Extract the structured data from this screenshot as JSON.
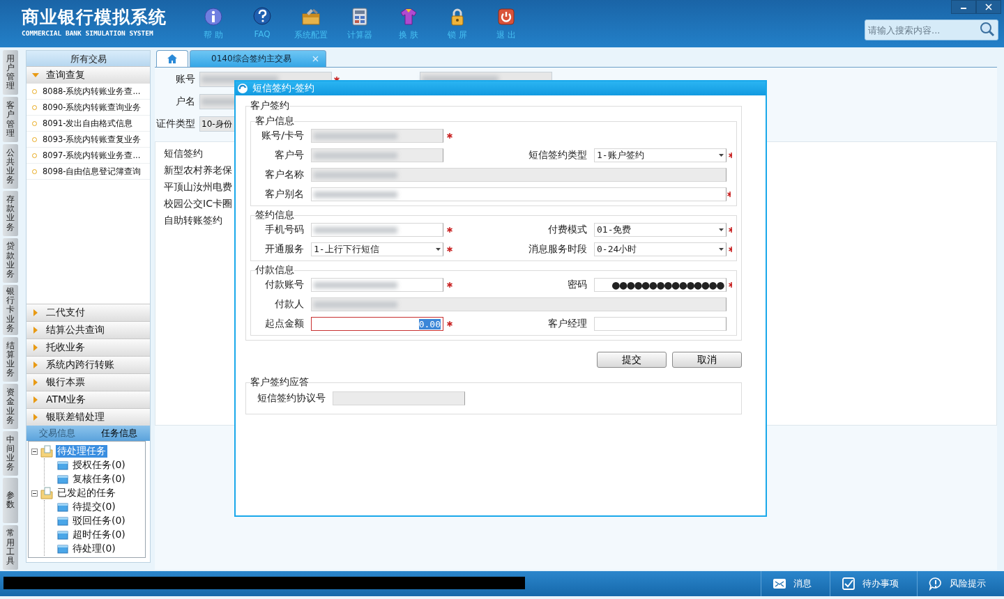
{
  "header": {
    "title": "商业银行模拟系统",
    "subtitle": "COMMERCIAL BANK SIMULATION SYSTEM",
    "tools": [
      {
        "label": "帮 助"
      },
      {
        "label": "FAQ"
      },
      {
        "label": "系统配置"
      },
      {
        "label": "计算器"
      },
      {
        "label": "换 肤"
      },
      {
        "label": "锁 屏"
      },
      {
        "label": "退 出"
      }
    ],
    "search": {
      "placeholder": "请输入搜索内容..."
    }
  },
  "side_tabs": [
    {
      "label": "用户管理"
    },
    {
      "label": "客户管理"
    },
    {
      "label": "公共业务"
    },
    {
      "label": "存款业务"
    },
    {
      "label": "贷款业务"
    },
    {
      "label": "银行卡业务"
    },
    {
      "label": "结算业务"
    },
    {
      "label": "资金业务"
    },
    {
      "label": "中间业务"
    },
    {
      "label": "参数"
    },
    {
      "label": "常用工具"
    }
  ],
  "nav": {
    "title": "所有交易",
    "groups": [
      {
        "label": "查询查复",
        "expanded": true,
        "items": [
          "8088-系统内转账业务查...",
          "8090-系统内转账查询业务",
          "8091-发出自由格式信息",
          "8093-系统内转账查复业务",
          "8097-系统内转账业务查...",
          "8098-自由信息登记簿查询"
        ]
      },
      {
        "label": "二代支付",
        "expanded": false
      },
      {
        "label": "结算公共查询",
        "expanded": false
      },
      {
        "label": "托收业务",
        "expanded": false
      },
      {
        "label": "系统内跨行转账",
        "expanded": false
      },
      {
        "label": "银行本票",
        "expanded": false
      },
      {
        "label": "ATM业务",
        "expanded": false
      },
      {
        "label": "银联差错处理",
        "expanded": false
      }
    ],
    "tabs": [
      {
        "label": "交易信息",
        "selected": false
      },
      {
        "label": "任务信息",
        "selected": true
      }
    ],
    "tree": [
      {
        "label": "待处理任务",
        "selected": true,
        "expanded": true,
        "children": [
          {
            "label": "授权任务(0)",
            "selected": false
          },
          {
            "label": "复核任务(0)",
            "selected": false
          }
        ]
      },
      {
        "label": "已发起的任务",
        "selected": false,
        "expanded": true,
        "children": [
          {
            "label": "待提交(0)",
            "selected": false
          },
          {
            "label": "驳回任务(0)",
            "selected": false
          },
          {
            "label": "超时任务(0)",
            "selected": false
          },
          {
            "label": "待处理(0)",
            "selected": false
          }
        ]
      }
    ]
  },
  "main": {
    "tabs": [
      {
        "kind": "home",
        "selected": false
      },
      {
        "kind": "text",
        "label": "0140综合签约主交易",
        "selected": true
      }
    ],
    "form": [
      [
        {
          "label": "账号",
          "redacted": true,
          "required": true
        },
        {
          "redacted": true,
          "required": false
        }
      ],
      [
        {
          "label": "户名",
          "redacted": true,
          "required": false
        }
      ],
      [
        {
          "label": "证件类型",
          "value": "10-身份",
          "required": false
        }
      ]
    ],
    "list": [
      "短信签约",
      "新型农村养老保",
      "平顶山汝州电费",
      "校园公交IC卡圈",
      "自助转账签约"
    ]
  },
  "dialog": {
    "title": "短信签约-签约",
    "form": {
      "title": "客户签约",
      "groups": [
        {
          "title": "客户信息",
          "rows": [
            [
              {
                "label": "账号/卡号",
                "kind": "text",
                "readonly": true,
                "redacted": true,
                "required": true
              }
            ],
            [
              {
                "label": "客户号",
                "kind": "text",
                "readonly": true,
                "redacted": true,
                "required": false
              },
              {
                "label": "短信签约类型",
                "kind": "select",
                "value": "1-账户签约",
                "required": true
              }
            ],
            [
              {
                "label": "客户名称",
                "kind": "text",
                "wide": true,
                "readonly": true,
                "redacted": true,
                "required": false
              }
            ],
            [
              {
                "label": "客户别名",
                "kind": "text",
                "wide": true,
                "readonly": false,
                "redacted": true,
                "required": true
              }
            ]
          ]
        },
        {
          "title": "签约信息",
          "rows": [
            [
              {
                "label": "手机号码",
                "kind": "text",
                "readonly": false,
                "redacted": true,
                "required": true
              },
              {
                "label": "付费模式",
                "kind": "select",
                "value": "01-免费",
                "required": true
              }
            ],
            [
              {
                "label": "开通服务",
                "kind": "select",
                "value": "1-上行下行短信",
                "required": true
              },
              {
                "label": "消息服务时段",
                "kind": "select",
                "value": "0-24小时",
                "required": true
              }
            ]
          ]
        },
        {
          "title": "付款信息",
          "rows": [
            [
              {
                "label": "付款账号",
                "kind": "text",
                "readonly": false,
                "redacted": true,
                "required": true
              },
              {
                "label": "密码",
                "kind": "text",
                "value": "●●●●●●●●●●●●●●●",
                "readonly": false,
                "required": true
              }
            ],
            [
              {
                "label": "付款人",
                "kind": "text",
                "wide": true,
                "readonly": true,
                "redacted": true,
                "required": false
              }
            ],
            [
              {
                "label": "起点金额",
                "kind": "amount",
                "value": "0.00",
                "focused": true,
                "required": true
              },
              {
                "label": "客户经理",
                "kind": "text",
                "readonly": false,
                "required": false
              }
            ]
          ]
        }
      ]
    },
    "buttons": [
      "提交",
      "取消"
    ],
    "response": {
      "title": "客户签约应答",
      "field": {
        "label": "短信签约协议号",
        "readonly": true
      }
    }
  },
  "status_bar": {
    "items": [
      {
        "label": "消息"
      },
      {
        "label": "待办事项"
      },
      {
        "label": "风险提示"
      }
    ]
  }
}
